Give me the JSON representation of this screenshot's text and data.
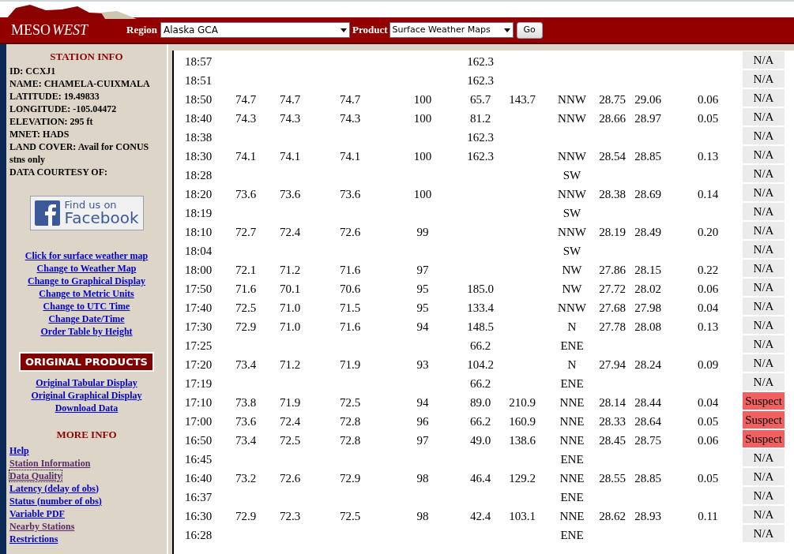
{
  "header": {
    "logo": {
      "part_1": "MESO",
      "part_2": "WEST"
    },
    "region": {
      "label": "Region",
      "value": "Alaska GCA"
    },
    "product": {
      "label": "Product",
      "value": "Surface Weather Maps"
    },
    "go_button": "Go"
  },
  "sidebar": {
    "station_info": {
      "title": "STATION INFO",
      "lines": [
        "ID: CCXJ1",
        "NAME: CHAMELA-CUIXMALA",
        "LATITUDE: 19.49833",
        "LONGITUDE: -105.04472",
        "ELEVATION: 295 ft",
        "MNET: HADS",
        "LAND COVER: Avail for CONUS stns only",
        "DATA COURTESY OF:"
      ]
    },
    "facebook": {
      "line_1": "Find us on",
      "line_2": "Facebook"
    },
    "display_links": [
      {
        "label": "Click for surface weather map",
        "visited": false
      },
      {
        "label": "Change to Weather Map",
        "visited": false
      },
      {
        "label": "Change to Graphical Display",
        "visited": false
      },
      {
        "label": "Change to Metric Units",
        "visited": false
      },
      {
        "label": "Change to UTC Time",
        "visited": false
      },
      {
        "label": "Change Date/Time",
        "visited": false
      },
      {
        "label": "Order Table by Height",
        "visited": false
      }
    ],
    "original_products": {
      "title": "ORIGINAL PRODUCTS",
      "links": [
        {
          "label": "Original Tabular Display",
          "visited": false
        },
        {
          "label": "Original Graphical Display",
          "visited": false
        },
        {
          "label": "Download Data",
          "visited": false
        }
      ]
    },
    "more_info": {
      "title": "MORE INFO",
      "links": [
        {
          "label": "Help",
          "visited": false,
          "focused": false
        },
        {
          "label": "Station Information",
          "visited": true,
          "focused": false
        },
        {
          "label": "Data Quality",
          "visited": true,
          "focused": true
        },
        {
          "label": "Latency (delay of obs)",
          "visited": false,
          "focused": false
        },
        {
          "label": "Status (number of obs)",
          "visited": false,
          "focused": false
        },
        {
          "label": "Variable PDF",
          "visited": false,
          "focused": false
        },
        {
          "label": "Nearby Stations",
          "visited": true,
          "focused": false
        },
        {
          "label": "Restrictions",
          "visited": false,
          "focused": false
        }
      ]
    }
  },
  "table": {
    "rows": [
      {
        "time": "18:57",
        "cells": {
          "column_6": "162.3"
        },
        "status": {
          "text": "N/A",
          "flagged": false
        }
      },
      {
        "time": "18:51",
        "cells": {
          "column_6": "162.3"
        },
        "status": {
          "text": "N/A",
          "flagged": false
        }
      },
      {
        "time": "18:50",
        "cells": {
          "column_2": "74.7",
          "column_3": "74.7",
          "column_4": "74.7",
          "column_5": "100",
          "column_6": "65.7",
          "column_7": "143.7",
          "column_8": "NNW",
          "column_9": "28.75",
          "column_10": "29.06",
          "column_11": "0.06"
        },
        "status": {
          "text": "N/A",
          "flagged": false
        }
      },
      {
        "time": "18:40",
        "cells": {
          "column_2": "74.3",
          "column_3": "74.3",
          "column_4": "74.3",
          "column_5": "100",
          "column_6": "81.2",
          "column_8": "NNW",
          "column_9": "28.66",
          "column_10": "28.97",
          "column_11": "0.05"
        },
        "status": {
          "text": "N/A",
          "flagged": false
        }
      },
      {
        "time": "18:38",
        "cells": {
          "column_6": "162.3"
        },
        "status": {
          "text": "N/A",
          "flagged": false
        }
      },
      {
        "time": "18:30",
        "cells": {
          "column_2": "74.1",
          "column_3": "74.1",
          "column_4": "74.1",
          "column_5": "100",
          "column_6": "162.3",
          "column_8": "NNW",
          "column_9": "28.54",
          "column_10": "28.85",
          "column_11": "0.13"
        },
        "status": {
          "text": "N/A",
          "flagged": false
        }
      },
      {
        "time": "18:28",
        "cells": {
          "column_8": "SW"
        },
        "status": {
          "text": "N/A",
          "flagged": false
        }
      },
      {
        "time": "18:20",
        "cells": {
          "column_2": "73.6",
          "column_3": "73.6",
          "column_4": "73.6",
          "column_5": "100",
          "column_8": "NNW",
          "column_9": "28.38",
          "column_10": "28.69",
          "column_11": "0.14"
        },
        "status": {
          "text": "N/A",
          "flagged": false
        }
      },
      {
        "time": "18:19",
        "cells": {
          "column_8": "SW"
        },
        "status": {
          "text": "N/A",
          "flagged": false
        }
      },
      {
        "time": "18:10",
        "cells": {
          "column_2": "72.7",
          "column_3": "72.4",
          "column_4": "72.6",
          "column_5": "99",
          "column_8": "NNW",
          "column_9": "28.19",
          "column_10": "28.49",
          "column_11": "0.20"
        },
        "status": {
          "text": "N/A",
          "flagged": false
        }
      },
      {
        "time": "18:04",
        "cells": {
          "column_8": "SW"
        },
        "status": {
          "text": "N/A",
          "flagged": false
        }
      },
      {
        "time": "18:00",
        "cells": {
          "column_2": "72.1",
          "column_3": "71.2",
          "column_4": "71.6",
          "column_5": "97",
          "column_8": "NW",
          "column_9": "27.86",
          "column_10": "28.15",
          "column_11": "0.22"
        },
        "status": {
          "text": "N/A",
          "flagged": false
        }
      },
      {
        "time": "17:50",
        "cells": {
          "column_2": "71.6",
          "column_3": "70.1",
          "column_4": "70.6",
          "column_5": "95",
          "column_6": "185.0",
          "column_8": "NW",
          "column_9": "27.72",
          "column_10": "28.02",
          "column_11": "0.06"
        },
        "status": {
          "text": "N/A",
          "flagged": false
        }
      },
      {
        "time": "17:40",
        "cells": {
          "column_2": "72.5",
          "column_3": "71.0",
          "column_4": "71.5",
          "column_5": "95",
          "column_6": "133.4",
          "column_8": "NNW",
          "column_9": "27.68",
          "column_10": "27.98",
          "column_11": "0.04"
        },
        "status": {
          "text": "N/A",
          "flagged": false
        }
      },
      {
        "time": "17:30",
        "cells": {
          "column_2": "72.9",
          "column_3": "71.0",
          "column_4": "71.6",
          "column_5": "94",
          "column_6": "148.5",
          "column_8": "N",
          "column_9": "27.78",
          "column_10": "28.08",
          "column_11": "0.13"
        },
        "status": {
          "text": "N/A",
          "flagged": false
        }
      },
      {
        "time": "17:25",
        "cells": {
          "column_6": "66.2",
          "column_8": "ENE"
        },
        "status": {
          "text": "N/A",
          "flagged": false
        }
      },
      {
        "time": "17:20",
        "cells": {
          "column_2": "73.4",
          "column_3": "71.2",
          "column_4": "71.9",
          "column_5": "93",
          "column_6": "104.2",
          "column_8": "N",
          "column_9": "27.94",
          "column_10": "28.24",
          "column_11": "0.09"
        },
        "status": {
          "text": "N/A",
          "flagged": false
        }
      },
      {
        "time": "17:19",
        "cells": {
          "column_6": "66.2",
          "column_8": "ENE"
        },
        "status": {
          "text": "N/A",
          "flagged": false
        }
      },
      {
        "time": "17:10",
        "cells": {
          "column_2": "73.8",
          "column_3": "71.9",
          "column_4": "72.5",
          "column_5": "94",
          "column_6": "89.0",
          "column_7": "210.9",
          "column_8": "NNE",
          "column_9": "28.14",
          "column_10": "28.44",
          "column_11": "0.04"
        },
        "status": {
          "text": "Suspect",
          "flagged": true
        }
      },
      {
        "time": "17:00",
        "cells": {
          "column_2": "73.6",
          "column_3": "72.4",
          "column_4": "72.8",
          "column_5": "96",
          "column_6": "66.2",
          "column_7": "160.9",
          "column_8": "NNE",
          "column_9": "28.33",
          "column_10": "28.64",
          "column_11": "0.05"
        },
        "status": {
          "text": "Suspect",
          "flagged": true
        }
      },
      {
        "time": "16:50",
        "cells": {
          "column_2": "73.4",
          "column_3": "72.5",
          "column_4": "72.8",
          "column_5": "97",
          "column_6": "49.0",
          "column_7": "138.6",
          "column_8": "NNE",
          "column_9": "28.45",
          "column_10": "28.75",
          "column_11": "0.06"
        },
        "status": {
          "text": "Suspect",
          "flagged": true
        }
      },
      {
        "time": "16:45",
        "cells": {
          "column_8": "ENE"
        },
        "status": {
          "text": "N/A",
          "flagged": false
        }
      },
      {
        "time": "16:40",
        "cells": {
          "column_2": "73.2",
          "column_3": "72.6",
          "column_4": "72.9",
          "column_5": "98",
          "column_6": "46.4",
          "column_7": "129.2",
          "column_8": "NNE",
          "column_9": "28.55",
          "column_10": "28.85",
          "column_11": "0.05"
        },
        "status": {
          "text": "N/A",
          "flagged": false
        }
      },
      {
        "time": "16:37",
        "cells": {
          "column_8": "ENE"
        },
        "status": {
          "text": "N/A",
          "flagged": false
        }
      },
      {
        "time": "16:30",
        "cells": {
          "column_2": "72.9",
          "column_3": "72.3",
          "column_4": "72.5",
          "column_5": "98",
          "column_6": "42.4",
          "column_7": "103.1",
          "column_8": "NNE",
          "column_9": "28.62",
          "column_10": "28.93",
          "column_11": "0.11"
        },
        "status": {
          "text": "N/A",
          "flagged": false
        }
      },
      {
        "time": "16:28",
        "cells": {
          "column_8": "ENE"
        },
        "status": {
          "text": "N/A",
          "flagged": false
        }
      }
    ]
  }
}
